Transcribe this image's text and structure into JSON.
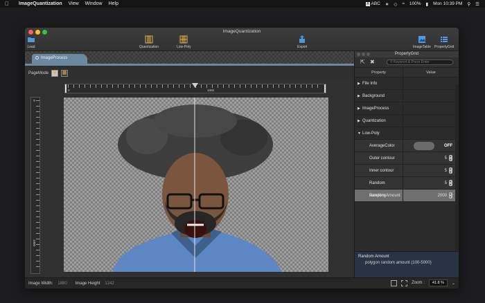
{
  "menubar": {
    "apple": "",
    "app_name": "ImageQuantization",
    "items": [
      "View",
      "Window",
      "Help"
    ],
    "keyboard": "ABC",
    "battery": "100%",
    "clock": "Mon 10:39 PM"
  },
  "window": {
    "title": "ImageQuantization",
    "toolbar": {
      "load": "Load",
      "quantization": "Quantization",
      "lowpoly": "Low-Poly",
      "export": "Export",
      "imagetable": "ImageTable",
      "propertygrid": "PropertyGrid"
    },
    "doc_tab": "ImageProcess",
    "pagemode_label": "PageMode",
    "ruler": {
      "h_start": "0",
      "h_mid": "1000",
      "v_start": "0",
      "v_mid": "1000"
    }
  },
  "property_grid": {
    "title": "PropertyGrid",
    "search_placeholder": "Keyword & Press Enter",
    "col_property": "Property",
    "col_value": "Value",
    "categories": {
      "file_info": "File Info",
      "background": "Background",
      "image_process": "ImageProcess",
      "quantization": "Quantization",
      "low_poly": "Low-Poly"
    },
    "low_poly": {
      "average_color": {
        "label": "AverageColor",
        "value": "OFF"
      },
      "outer_contour": {
        "label": "Outer contour",
        "value": "5"
      },
      "inner_contour": {
        "label": "Inner contour",
        "value": "5"
      },
      "random_sampling": {
        "label": "Random sampling",
        "value": "5"
      },
      "random_amount": {
        "label": "Random Amount",
        "value": "2000"
      }
    },
    "description": {
      "title": "Random Amount",
      "text": "polygon random amount (100-5000)"
    }
  },
  "statusbar": {
    "width_label": "Image Width:",
    "width_value": "1880",
    "height_label": "Image Height",
    "height_value": "1242",
    "zoom_label": "Zoom :",
    "zoom_value": "41.8 %"
  },
  "colors": {
    "accent_tab": "#6a8aa0",
    "selected_row": "#6f6f6f",
    "shirt": "#5c87c4"
  }
}
